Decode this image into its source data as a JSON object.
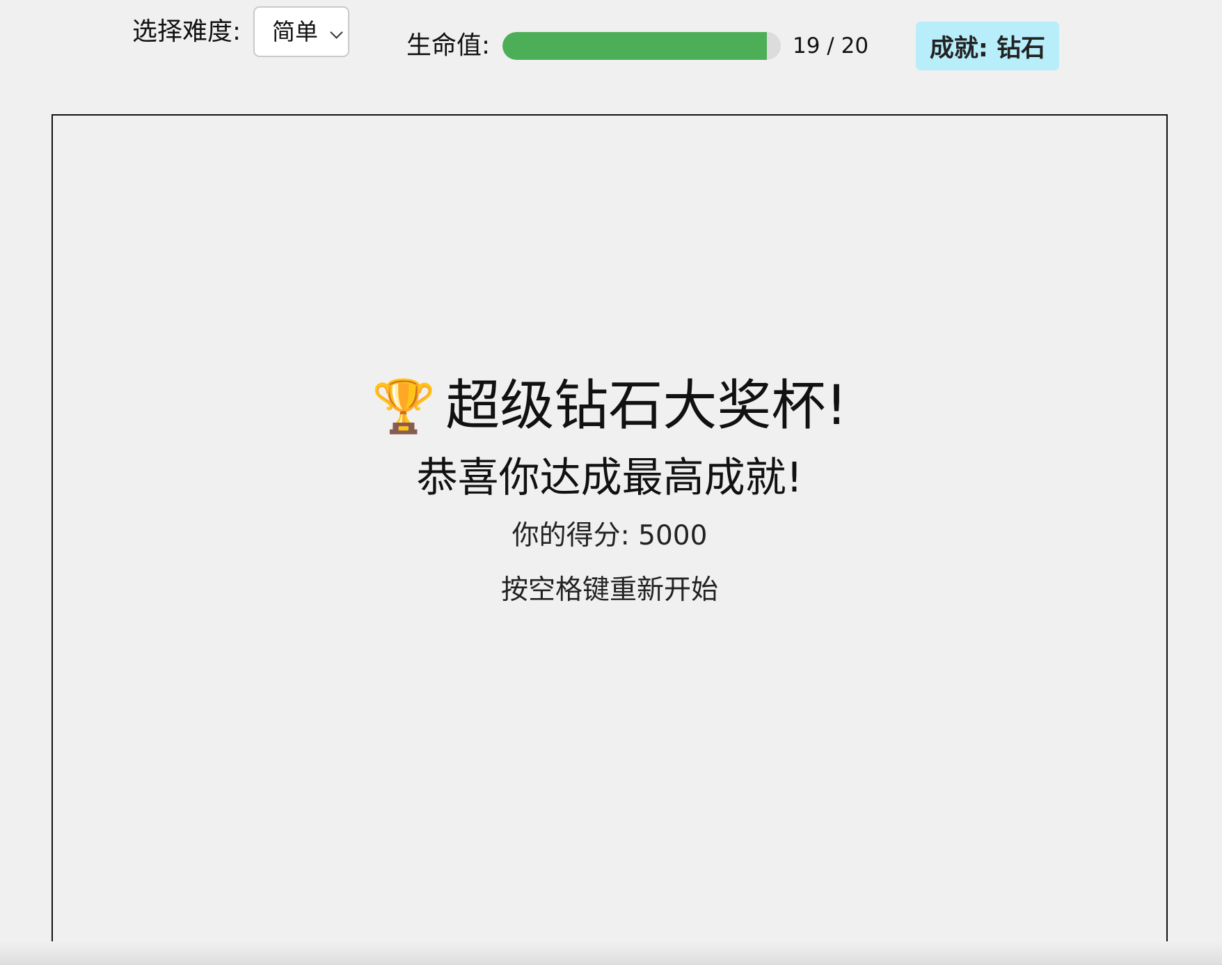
{
  "controls": {
    "difficulty_label": "选择难度:",
    "difficulty_selected": "简单",
    "hp_label": "生命值:",
    "hp_current": 19,
    "hp_max": 20,
    "hp_text": "19 / 20",
    "hp_fill_color": "#4caf57",
    "achievement_badge": "成就: 钻石",
    "achievement_badge_color": "#b7eefa"
  },
  "game": {
    "title_icon": "🏆",
    "title_icon_name": "trophy-icon",
    "title": "超级钻石大奖杯!",
    "subtitle": "恭喜你达成最高成就!",
    "score_line": "你的得分: 5000",
    "restart_hint": "按空格键重新开始"
  }
}
